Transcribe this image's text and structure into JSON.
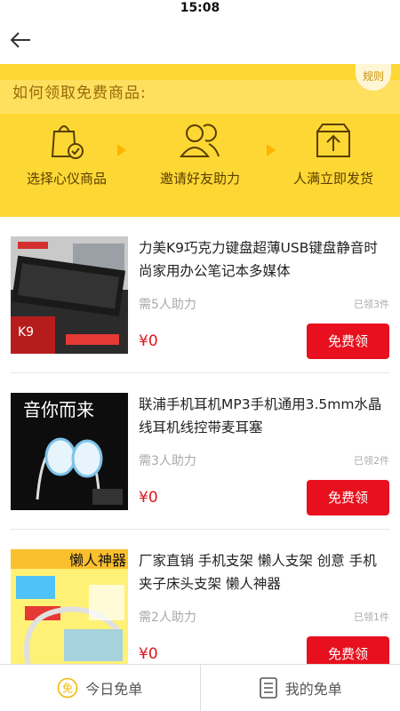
{
  "status": {
    "time": "15:08"
  },
  "banner": {
    "title": "如何领取免费商品:",
    "rules": "规则",
    "steps": [
      {
        "label": "选择心仪商品",
        "icon": "shopping-bag-check-icon"
      },
      {
        "label": "邀请好友助力",
        "icon": "friends-icon"
      },
      {
        "label": "人满立即发货",
        "icon": "box-upload-icon"
      }
    ]
  },
  "products": [
    {
      "title": "力美K9巧克力键盘超薄USB键盘静音时尚家用办公笔记本多媒体",
      "need": "需5人助力",
      "claimed": "已领3件",
      "price": "¥0",
      "button": "免费领",
      "image_text": "K9"
    },
    {
      "title": "联浦手机耳机MP3手机通用3.5mm水晶线耳机线控带麦耳塞",
      "need": "需3人助力",
      "claimed": "已领2件",
      "price": "¥0",
      "button": "免费领",
      "image_text": "音你而来"
    },
    {
      "title": "厂家直销 手机支架 懒人支架 创意 手机夹子床头支架 懒人神器",
      "need": "需2人助力",
      "claimed": "已领1件",
      "price": "¥0",
      "button": "免费领",
      "image_text": "懒人神器"
    }
  ],
  "tabbar": {
    "today": "今日免单",
    "mine": "我的免单",
    "today_icon_glyph": "免"
  },
  "colors": {
    "accent": "#e8101e",
    "banner": "#fdd835"
  }
}
